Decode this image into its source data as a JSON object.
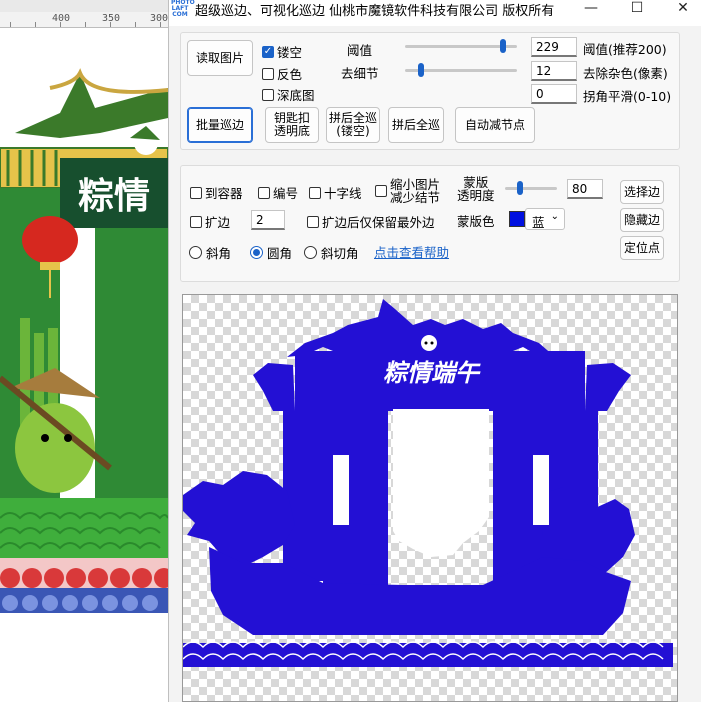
{
  "background_app": {
    "ruler_labels": [
      "400",
      "350",
      "300"
    ]
  },
  "window": {
    "title": "超级巡边、可视化巡边      仙桃市魔镜软件科技有限公司  版权所有",
    "logo_text": "PHOTO LAFT COM",
    "minimize": "—",
    "maximize": "☐",
    "close": "✕"
  },
  "top_panel": {
    "read_image": "读取图片",
    "batch_trace": "批量巡边",
    "keychain_transparent": "钥匙扣\n透明底",
    "merge_full_hollow": "拼后全巡\n(镂空)",
    "merge_full": "拼后全巡",
    "auto_reduce_nodes": "自动减节点",
    "hollow": {
      "label": "镂空",
      "checked": true
    },
    "invert": {
      "label": "反色",
      "checked": false
    },
    "dark_bg": {
      "label": "深底图",
      "checked": false
    },
    "threshold_label": "阈值",
    "threshold_value": "229",
    "threshold_hint": "阈值(推荐200)",
    "threshold_level": 0.9,
    "remove_detail_label": "去细节",
    "remove_detail_value": "12",
    "remove_detail_hint": "去除杂色(像素)",
    "remove_detail_level": 0.12,
    "corner_smooth_value": "0",
    "corner_smooth_hint": "拐角平滑(0-10)"
  },
  "mid_panel": {
    "to_container": {
      "label": "到容器",
      "checked": false
    },
    "numbering": {
      "label": "编号",
      "checked": false
    },
    "crosshair": {
      "label": "十字线",
      "checked": false
    },
    "shrink_image": {
      "label": "缩小图片\n减少结节",
      "checked": false
    },
    "mask_opacity_label": "蒙版\n透明度",
    "mask_opacity_value": "80",
    "mask_opacity_level": 0.25,
    "expand_edge": {
      "label": "扩边",
      "checked": false
    },
    "expand_value": "2",
    "expand_keep_outer": {
      "label": "扩边后仅保留最外边",
      "checked": false
    },
    "mask_color_label": "蒙版色",
    "mask_color_value": "蓝",
    "mask_color": "#0010e0",
    "corner_bevel": {
      "label": "斜角",
      "checked": false
    },
    "corner_round": {
      "label": "圆角",
      "checked": true
    },
    "corner_chamfer": {
      "label": "斜切角",
      "checked": false
    },
    "help_link": "点击查看帮助",
    "select_edge": "选择边",
    "hide_edge": "隐藏边",
    "locate_point": "定位点"
  },
  "preview": {
    "silhouette_text": "粽情端午",
    "silhouette_color": "#2310d4"
  }
}
